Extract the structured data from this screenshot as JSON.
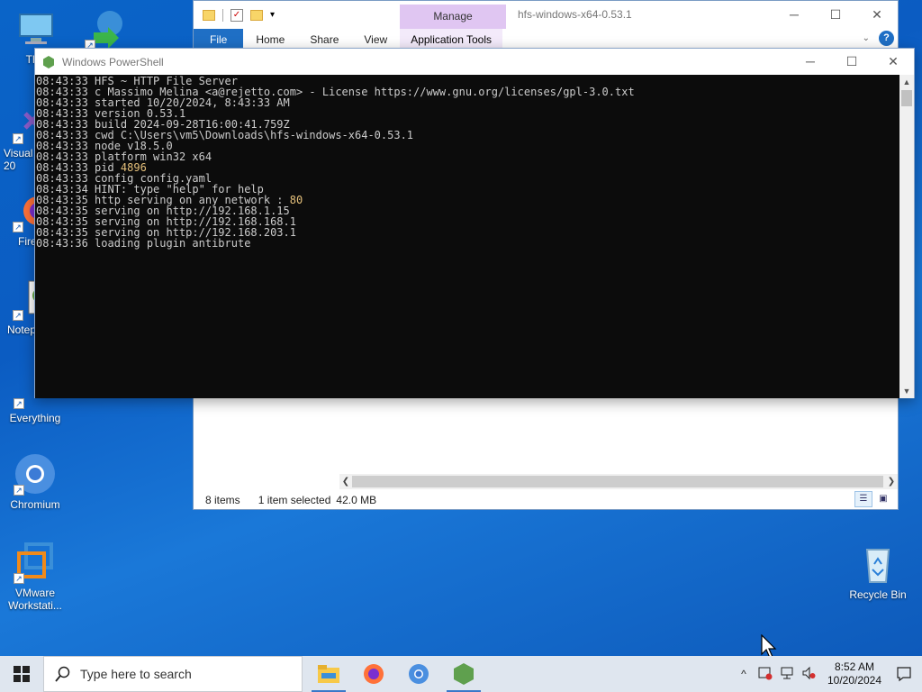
{
  "desktop": {
    "icons": [
      {
        "label": "This"
      },
      {
        "label": ""
      },
      {
        "label": "Visual\n20"
      },
      {
        "label": "Fire"
      },
      {
        "label": "Notep"
      },
      {
        "label": "Everything"
      },
      {
        "label": "Chromium"
      },
      {
        "label": "VMware\nWorkstati..."
      },
      {
        "label": "Recycle Bin"
      }
    ]
  },
  "explorer": {
    "manage_tab": "Manage",
    "title": "hfs-windows-x64-0.53.1",
    "ribbon_tabs": [
      "File",
      "Home",
      "Share",
      "View",
      "Application Tools"
    ],
    "help_label": "?",
    "status": {
      "items": "8 items",
      "selected": "1 item selected",
      "size": "42.0 MB"
    }
  },
  "powershell": {
    "title": "Windows PowerShell",
    "lines": [
      [
        "08:43:33 HFS ~ HTTP File Server",
        ""
      ],
      [
        "08:43:33 c Massimo Melina <a@rejetto.com> - License https://www.gnu.org/licenses/gpl-3.0.txt",
        ""
      ],
      [
        "08:43:33 started 10/20/2024, 8:43:33 AM",
        ""
      ],
      [
        "08:43:33 version 0.53.1",
        ""
      ],
      [
        "08:43:33 build 2024-09-28T16:00:41.759Z",
        ""
      ],
      [
        "08:43:33 cwd C:\\Users\\vm5\\Downloads\\hfs-windows-x64-0.53.1",
        ""
      ],
      [
        "08:43:33 node v18.5.0",
        ""
      ],
      [
        "08:43:33 platform win32 x64",
        ""
      ],
      [
        "08:43:33 pid ",
        "4896"
      ],
      [
        "08:43:33 config config.yaml",
        ""
      ],
      [
        "08:43:34 HINT: type \"help\" for help",
        ""
      ],
      [
        "08:43:35 http serving on any network : ",
        "80"
      ],
      [
        "08:43:35 serving on http://192.168.1.15",
        ""
      ],
      [
        "08:43:35 serving on http://192.168.168.1",
        ""
      ],
      [
        "08:43:35 serving on http://192.168.203.1",
        ""
      ],
      [
        "08:43:36 loading plugin antibrute",
        ""
      ]
    ]
  },
  "taskbar": {
    "search_placeholder": "Type here to search",
    "time": "8:52 AM",
    "date": "10/20/2024"
  },
  "colors": {
    "desktop_bg": "#0b5cc2",
    "console_bg": "#0c0c0c",
    "console_text": "#cccccc",
    "console_highlight": "#e5c07b",
    "manage_tab": "#e0c6f2",
    "file_tab": "#1f6fc5"
  }
}
